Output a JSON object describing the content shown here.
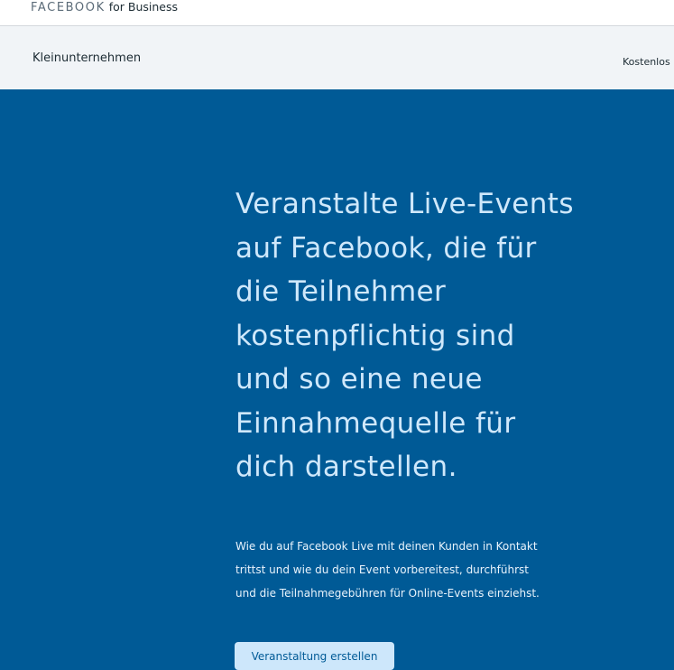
{
  "header": {
    "brand_main": "FACEBOOK",
    "brand_sub": "for Business"
  },
  "subnav": {
    "left_item": "Kleinunternehmen",
    "right_item": "Kostenlos"
  },
  "hero": {
    "title": "Veranstalte Live-Events auf Facebook, die für die Teilnehmer kostenpflichtig sind und so eine neue Einnahmequelle für dich darstellen.",
    "description": "Wie du auf Facebook Live mit deinen Kunden in Kontakt trittst und wie du dein Event vorbereitest, durchführst und die Teilnahmegebühren für Online-Events einziehst.",
    "cta_label": "Veranstaltung erstellen"
  },
  "colors": {
    "hero_background": "#005a96",
    "subnav_background": "#f1f4f7",
    "hero_title": "#cfe8fb",
    "cta_background": "#cde7fb"
  }
}
